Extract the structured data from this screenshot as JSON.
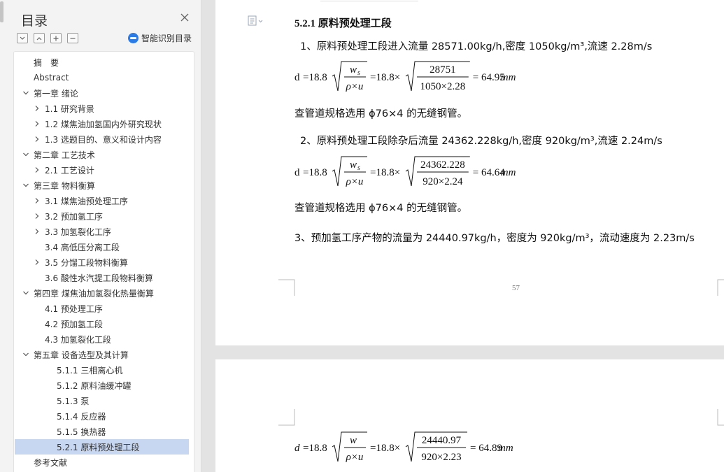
{
  "sidebar": {
    "title": "目录",
    "smart_toc_label": "智能识别目录",
    "items": [
      {
        "label": "摘　要",
        "level": 0,
        "expandable": false,
        "expanded": false,
        "selected": false
      },
      {
        "label": "Abstract",
        "level": 0,
        "expandable": false,
        "expanded": false,
        "selected": false
      },
      {
        "label": "第一章  绪论",
        "level": 0,
        "expandable": true,
        "expanded": true,
        "selected": false
      },
      {
        "label": "1.1 研究背景",
        "level": 1,
        "expandable": true,
        "expanded": false,
        "selected": false
      },
      {
        "label": "1.2  煤焦油加氢国内外研究现状",
        "level": 1,
        "expandable": true,
        "expanded": false,
        "selected": false
      },
      {
        "label": "1.3  选题目的、意义和设计内容",
        "level": 1,
        "expandable": true,
        "expanded": false,
        "selected": false
      },
      {
        "label": "第二章  工艺技术",
        "level": 0,
        "expandable": true,
        "expanded": true,
        "selected": false
      },
      {
        "label": "2.1 工艺设计",
        "level": 1,
        "expandable": true,
        "expanded": false,
        "selected": false
      },
      {
        "label": "第三章  物料衡算",
        "level": 0,
        "expandable": true,
        "expanded": true,
        "selected": false
      },
      {
        "label": "3.1 煤焦油预处理工序",
        "level": 1,
        "expandable": true,
        "expanded": false,
        "selected": false
      },
      {
        "label": "3.2 预加氢工序",
        "level": 1,
        "expandable": true,
        "expanded": false,
        "selected": false
      },
      {
        "label": "3.3 加氢裂化工序",
        "level": 1,
        "expandable": true,
        "expanded": false,
        "selected": false
      },
      {
        "label": "3.4 高低压分离工段",
        "level": 1,
        "expandable": false,
        "expanded": false,
        "selected": false
      },
      {
        "label": "3.5 分馏工段物料衡算",
        "level": 1,
        "expandable": true,
        "expanded": false,
        "selected": false
      },
      {
        "label": "3.6 酸性水汽提工段物料衡算",
        "level": 1,
        "expandable": false,
        "expanded": false,
        "selected": false
      },
      {
        "label": "第四章   煤焦油加氢裂化热量衡算",
        "level": 0,
        "expandable": true,
        "expanded": true,
        "selected": false
      },
      {
        "label": "4.1 预处理工序",
        "level": 1,
        "expandable": false,
        "expanded": false,
        "selected": false
      },
      {
        "label": "4.2 预加氢工段",
        "level": 1,
        "expandable": false,
        "expanded": false,
        "selected": false
      },
      {
        "label": "4.3 加氢裂化工段",
        "level": 1,
        "expandable": false,
        "expanded": false,
        "selected": false
      },
      {
        "label": "第五章  设备选型及其计算",
        "level": 0,
        "expandable": true,
        "expanded": true,
        "selected": false
      },
      {
        "label": "5.1.1 三相离心机",
        "level": 2,
        "expandable": false,
        "expanded": false,
        "selected": false
      },
      {
        "label": "5.1.2 原料油缓冲罐",
        "level": 2,
        "expandable": false,
        "expanded": false,
        "selected": false
      },
      {
        "label": "5.1.3 泵",
        "level": 2,
        "expandable": false,
        "expanded": false,
        "selected": false
      },
      {
        "label": "5.1.4 反应器",
        "level": 2,
        "expandable": false,
        "expanded": false,
        "selected": false
      },
      {
        "label": "5.1.5 换热器",
        "level": 2,
        "expandable": false,
        "expanded": false,
        "selected": false
      },
      {
        "label": "5.2.1 原料预处理工段",
        "level": 2,
        "expandable": false,
        "expanded": false,
        "selected": true
      },
      {
        "label": "参考文献",
        "level": 0,
        "expandable": false,
        "expanded": false,
        "selected": false
      }
    ]
  },
  "document": {
    "page1": {
      "heading": "5.2.1 原料预处理工段",
      "para1": "1、原料预处理工段进入流量 28571.00kg/h,密度 1050kg/m³,流速 2.28m/s",
      "formula1": {
        "lhs": "d",
        "coef": "18.8",
        "num_sym": "w",
        "num_sub": "s",
        "den_sym": "ρ×u",
        "frac_num": "28751",
        "frac_den": "1050×2.28",
        "result": "64.95",
        "unit": "mm"
      },
      "spec1": "查管道规格选用 ϕ76×4 的无缝钢管。",
      "para2": "2、原料预处理工段除杂后流量 24362.228kg/h,密度 920kg/m³,流速 2.24m/s",
      "formula2": {
        "lhs": "d",
        "coef": "18.8",
        "num_sym": "w",
        "num_sub": "s",
        "den_sym": "ρ×u",
        "frac_num": "24362.228",
        "frac_den": "920×2.24",
        "result": "64.64",
        "unit": "mm"
      },
      "spec2": "查管道规格选用 ϕ76×4 的无缝钢管。",
      "para3": "3、预加氢工序产物的流量为 24440.97kg/h，密度为 920kg/m³，流动速度为 2.23m/s",
      "page_number": "57"
    },
    "page2": {
      "formula3": {
        "lhs": "d",
        "coef": "18.8",
        "num_sym": "w",
        "num_sub": "",
        "den_sym": "ρ×u",
        "frac_num": "24440.97",
        "frac_den": "920×2.23",
        "result": "64.89",
        "unit": "mm"
      }
    }
  },
  "colors": {
    "selected_bg": "#c8d7f1",
    "accent": "#2c7be5"
  }
}
